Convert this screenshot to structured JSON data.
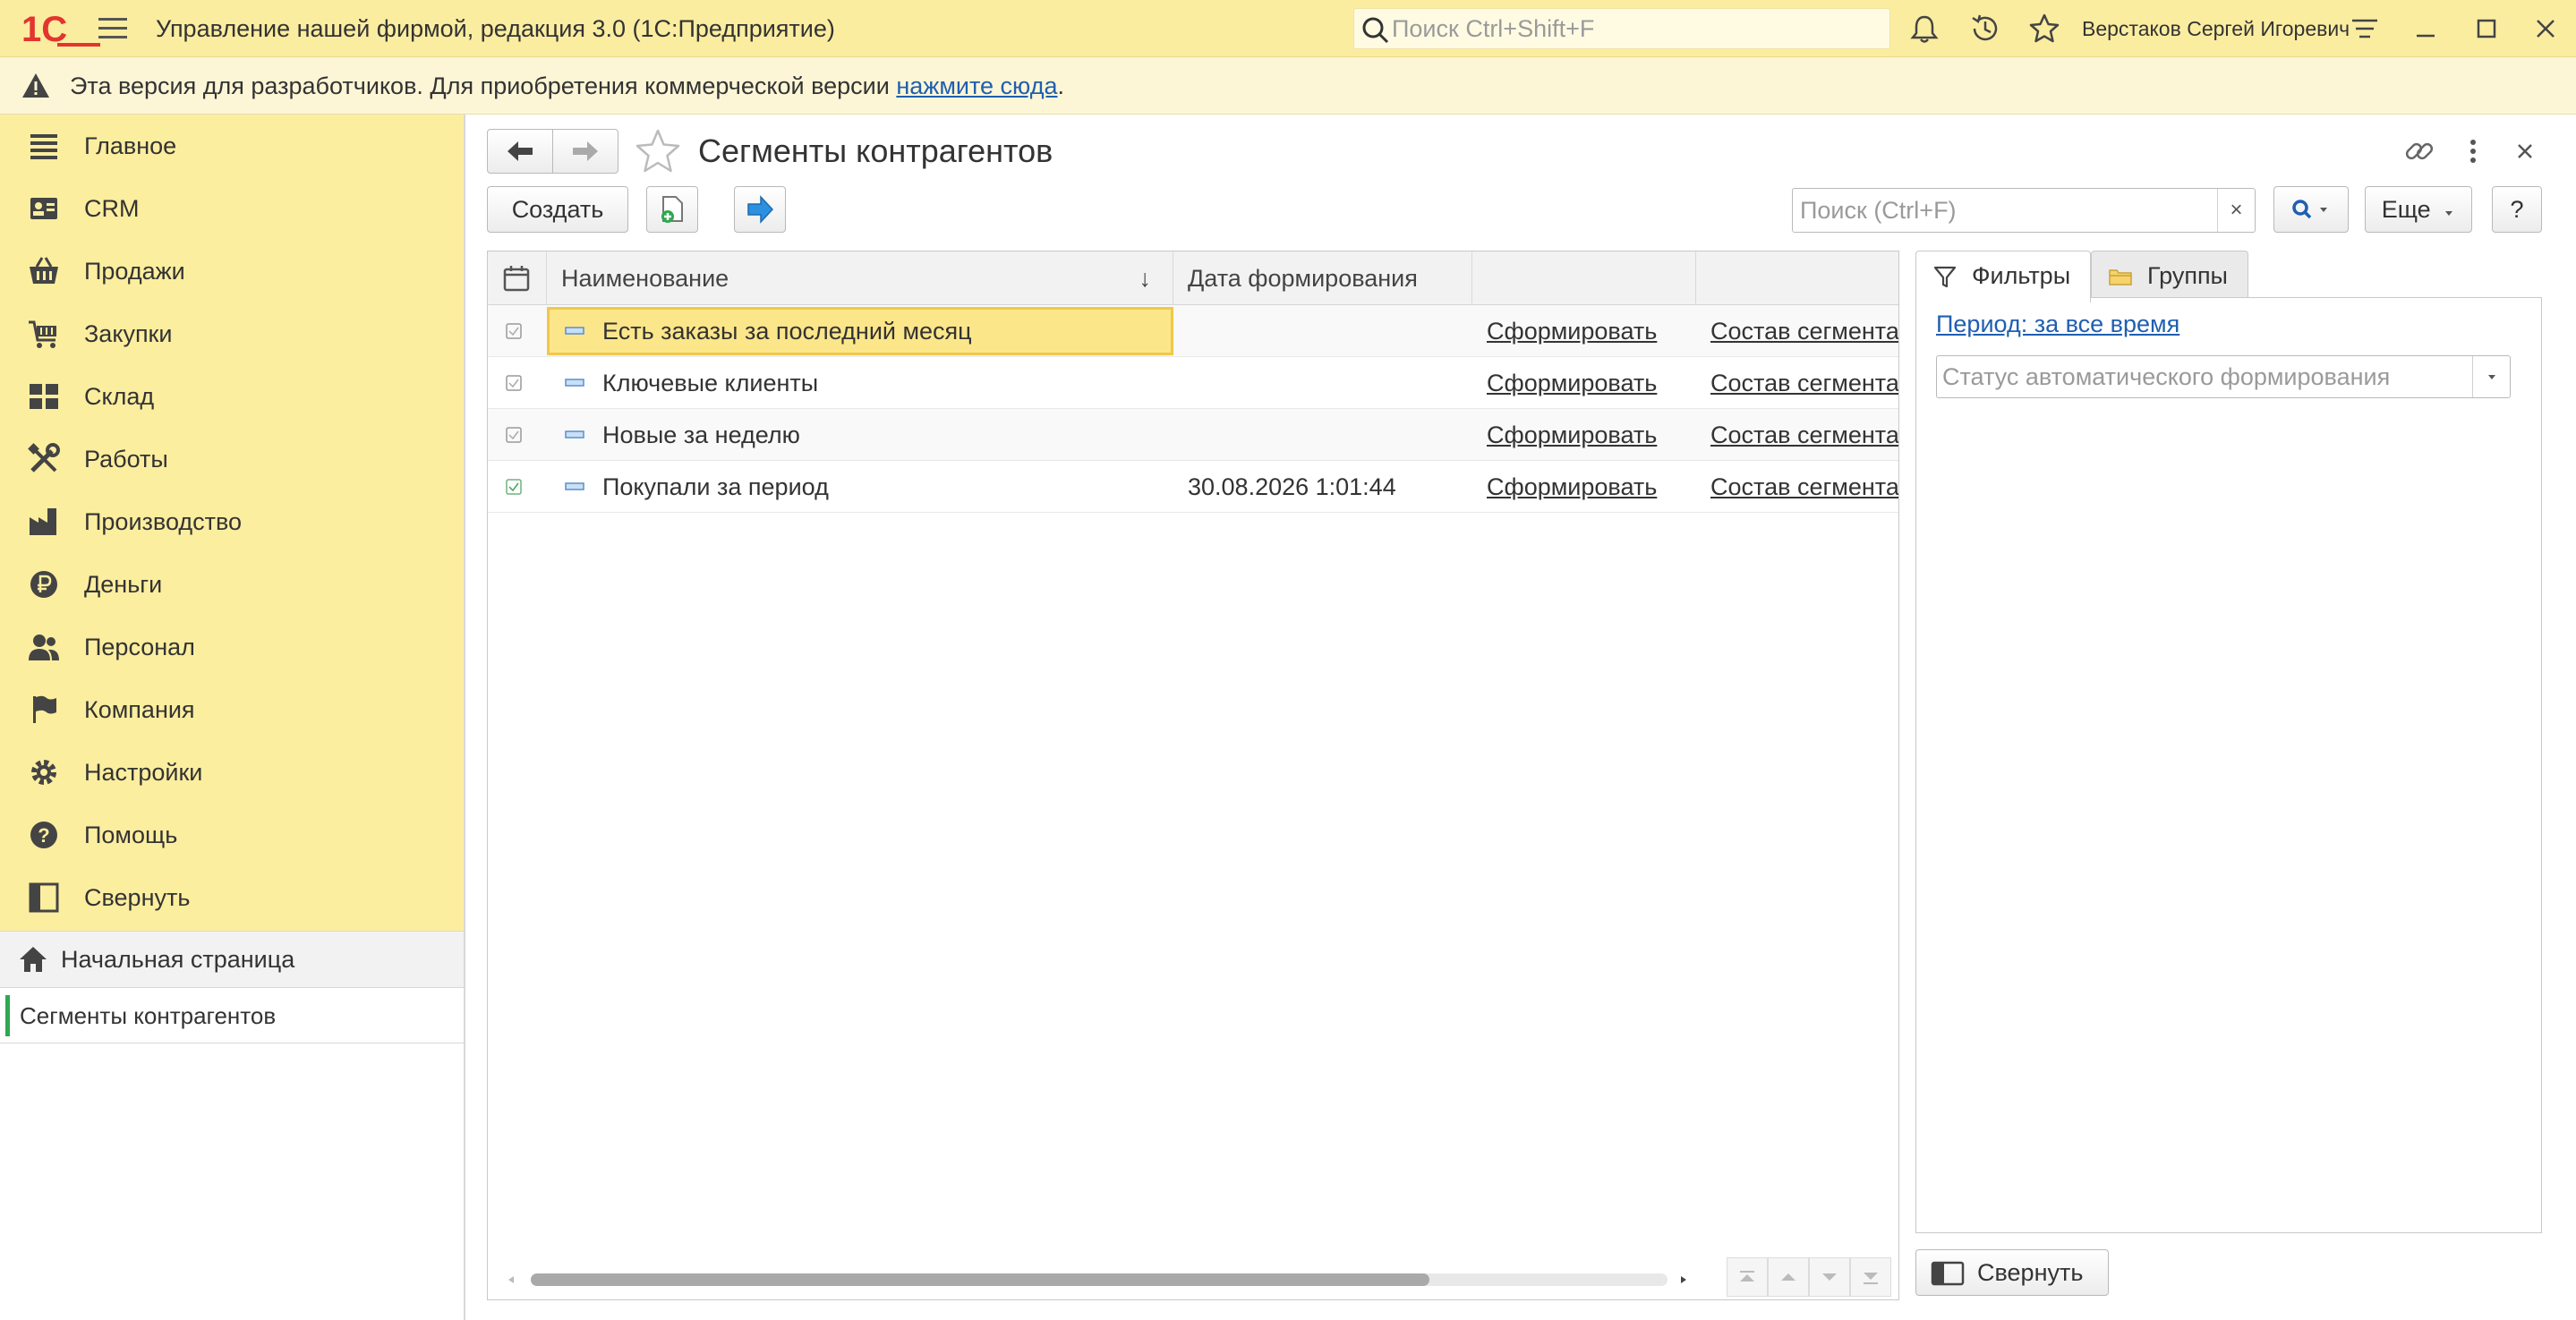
{
  "titlebar": {
    "logo_text": "1С",
    "app_title": "Управление нашей фирмой, редакция 3.0  (1С:Предприятие)",
    "search_placeholder": "Поиск Ctrl+Shift+F",
    "user_name": "Верстаков Сергей Игоревич"
  },
  "banner": {
    "text": "Эта версия для разработчиков. Для приобретения коммерческой версии ",
    "link_text": "нажмите сюда",
    "suffix": "."
  },
  "sidebar": {
    "sections": [
      {
        "label": "Главное",
        "icon": "menu-lines-icon"
      },
      {
        "label": "CRM",
        "icon": "contact-card-icon"
      },
      {
        "label": "Продажи",
        "icon": "basket-icon"
      },
      {
        "label": "Закупки",
        "icon": "cart-icon"
      },
      {
        "label": "Склад",
        "icon": "warehouse-grid-icon"
      },
      {
        "label": "Работы",
        "icon": "tools-icon"
      },
      {
        "label": "Производство",
        "icon": "factory-icon"
      },
      {
        "label": "Деньги",
        "icon": "ruble-coin-icon"
      },
      {
        "label": "Персонал",
        "icon": "people-icon"
      },
      {
        "label": "Компания",
        "icon": "flag-icon"
      },
      {
        "label": "Настройки",
        "icon": "gear-icon"
      },
      {
        "label": "Помощь",
        "icon": "question-icon"
      },
      {
        "label": "Свернуть",
        "icon": "collapse-panel-icon"
      }
    ],
    "home_label": "Начальная страница",
    "open_window_label": "Сегменты контрагентов"
  },
  "form": {
    "title": "Сегменты контрагентов",
    "create_label": "Создать",
    "search_placeholder": "Поиск (Ctrl+F)",
    "clear_label": "×",
    "more_label": "Еще",
    "help_label": "?"
  },
  "list": {
    "columns": [
      "Наименование",
      "Дата формирования",
      "",
      ""
    ],
    "sort_indicator": "↓",
    "rows": [
      {
        "name": "Есть заказы за последний месяц",
        "date": "",
        "action": "Сформировать",
        "composition": "Состав сегмента",
        "selected": true
      },
      {
        "name": "Ключевые клиенты",
        "date": "",
        "action": "Сформировать",
        "composition": "Состав сегмента",
        "selected": false
      },
      {
        "name": "Новые за неделю",
        "date": "",
        "action": "Сформировать",
        "composition": "Состав сегмента",
        "selected": false
      },
      {
        "name": "Покупали за период",
        "date": "30.08.2026 1:01:44",
        "action": "Сформировать",
        "composition": "Состав сегмента",
        "selected": false
      }
    ]
  },
  "filters": {
    "tab_filters": "Фильтры",
    "tab_groups": "Группы",
    "period_link": "Период: за все время",
    "status_placeholder": "Статус автоматического формирования",
    "collapse_label": "Свернуть"
  },
  "colors": {
    "accent_yellow": "#fcee9f",
    "link_blue": "#1f5fb0",
    "selection": "#fce68a",
    "active_window_bar": "#2fa84f",
    "logo_red": "#e3342f"
  }
}
